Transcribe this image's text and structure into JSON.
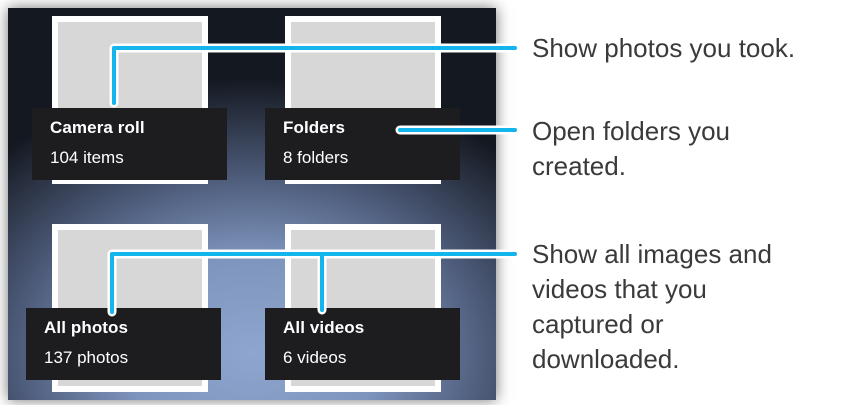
{
  "albums": [
    {
      "title": "Camera roll",
      "count": "104 items"
    },
    {
      "title": "Folders",
      "count": "8 folders"
    },
    {
      "title": "All photos",
      "count": "137 photos"
    },
    {
      "title": "All videos",
      "count": "6 videos"
    }
  ],
  "callouts": {
    "camera_roll": "Show photos you took.",
    "folders_line1": "Open folders you",
    "folders_line2": "created.",
    "all_line1": "Show all images and",
    "all_line2": "videos that you",
    "all_line3": "captured or",
    "all_line4": "downloaded."
  },
  "colors": {
    "callout_line": "#12b6ec",
    "caption_bg": "#1d1d1f"
  }
}
